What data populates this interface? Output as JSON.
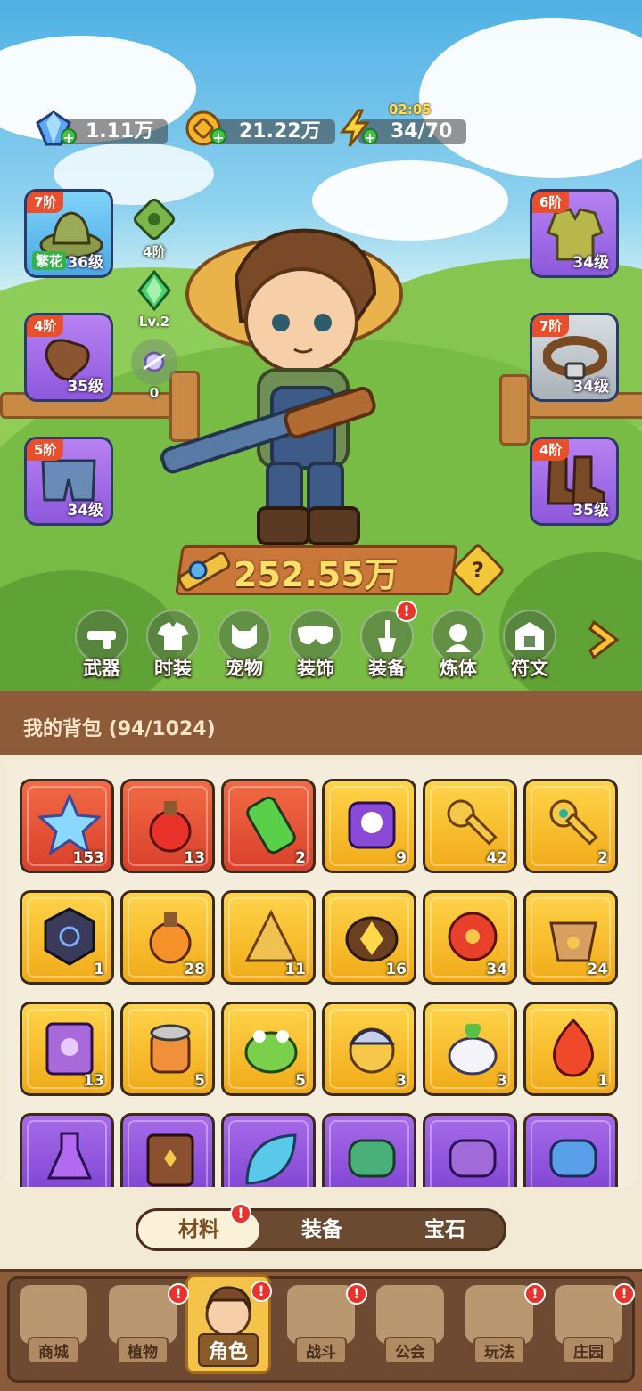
{
  "currency": {
    "gems": "1.11万",
    "coins": "21.22万",
    "energy": "34/70",
    "energy_timer": "02:05"
  },
  "equipment": {
    "hat": {
      "tier": "7阶",
      "level": "36级",
      "tag": "繁花"
    },
    "gloves": {
      "tier": "4阶",
      "level": "35级"
    },
    "pants": {
      "tier": "5阶",
      "level": "34级"
    },
    "armor": {
      "tier": "6阶",
      "level": "34级"
    },
    "belt": {
      "tier": "7阶",
      "level": "34级"
    },
    "boots": {
      "tier": "4阶",
      "level": "35级"
    }
  },
  "stats": {
    "pet_tier": "4阶",
    "gem_level": "Lv.2",
    "rune_count": "0"
  },
  "power": "252.55万",
  "functions": [
    {
      "label": "武器",
      "badge": ""
    },
    {
      "label": "时装",
      "badge": ""
    },
    {
      "label": "宠物",
      "badge": ""
    },
    {
      "label": "装饰",
      "badge": ""
    },
    {
      "label": "装备",
      "badge": "!"
    },
    {
      "label": "炼体",
      "badge": ""
    },
    {
      "label": "符文",
      "badge": ""
    }
  ],
  "bag": {
    "title": "我的背包 (94/1024)",
    "items": [
      {
        "count": "153",
        "rarity": "red",
        "icon": "crystal-star-icon"
      },
      {
        "count": "13",
        "rarity": "red",
        "icon": "red-potion-icon"
      },
      {
        "count": "2",
        "rarity": "red",
        "icon": "green-canister-icon"
      },
      {
        "count": "9",
        "rarity": "gold",
        "icon": "skull-bone-icon"
      },
      {
        "count": "42",
        "rarity": "gold",
        "icon": "gold-key-icon"
      },
      {
        "count": "2",
        "rarity": "gold",
        "icon": "emerald-key-icon"
      },
      {
        "count": "1",
        "rarity": "gold",
        "icon": "rune-stone-icon"
      },
      {
        "count": "28",
        "rarity": "gold",
        "icon": "orange-potion-icon"
      },
      {
        "count": "11",
        "rarity": "gold",
        "icon": "gold-sand-icon"
      },
      {
        "count": "16",
        "rarity": "gold",
        "icon": "gold-ore-icon"
      },
      {
        "count": "34",
        "rarity": "gold",
        "icon": "red-flower-icon"
      },
      {
        "count": "24",
        "rarity": "gold",
        "icon": "flower-pot-icon"
      },
      {
        "count": "13",
        "rarity": "gold",
        "icon": "spell-book-icon"
      },
      {
        "count": "5",
        "rarity": "gold",
        "icon": "tin-can-icon"
      },
      {
        "count": "5",
        "rarity": "gold",
        "icon": "green-frog-icon"
      },
      {
        "count": "3",
        "rarity": "gold",
        "icon": "owl-helmet-icon"
      },
      {
        "count": "3",
        "rarity": "gold",
        "icon": "radish-plant-icon"
      },
      {
        "count": "1",
        "rarity": "gold",
        "icon": "fire-spirit-icon"
      },
      {
        "count": "",
        "rarity": "violet",
        "icon": "purple-potion-icon"
      },
      {
        "count": "",
        "rarity": "violet",
        "icon": "brown-book-icon"
      },
      {
        "count": "",
        "rarity": "violet",
        "icon": "blue-leaf-icon"
      },
      {
        "count": "",
        "rarity": "violet",
        "icon": "green-scroll-icon"
      },
      {
        "count": "",
        "rarity": "violet",
        "icon": "purple-scroll-icon"
      },
      {
        "count": "",
        "rarity": "violet",
        "icon": "blue-scroll-icon"
      }
    ]
  },
  "tabs": [
    {
      "label": "材料",
      "active": true
    },
    {
      "label": "装备",
      "active": false
    },
    {
      "label": "宝石",
      "active": false
    }
  ],
  "nav": [
    {
      "label": "商城",
      "badge": ""
    },
    {
      "label": "植物",
      "badge": "!"
    },
    {
      "label": "角色",
      "badge": "!",
      "active": true
    },
    {
      "label": "战斗",
      "badge": "!"
    },
    {
      "label": "公会",
      "badge": ""
    },
    {
      "label": "玩法",
      "badge": "!"
    },
    {
      "label": "庄园",
      "badge": "!"
    }
  ],
  "colors": {
    "accent_gold": "#f0aa18",
    "rarity_red": "#d9402b",
    "rarity_violet": "#7a3fcf",
    "wood": "#8d5a3a"
  }
}
